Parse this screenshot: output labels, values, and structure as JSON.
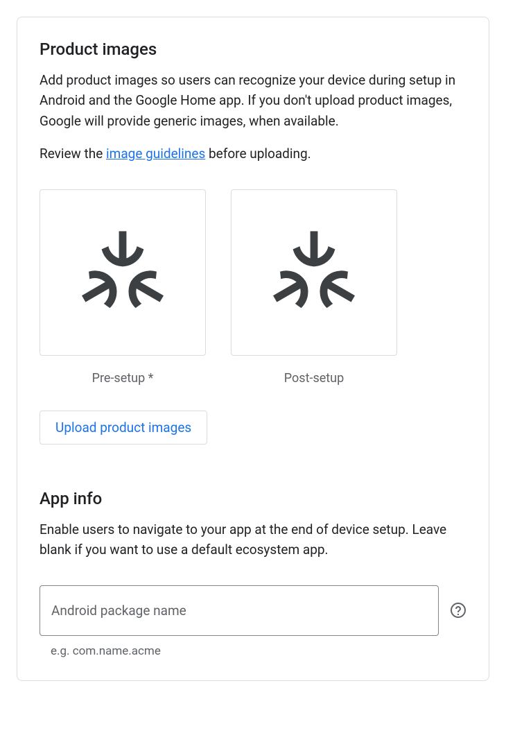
{
  "productImages": {
    "title": "Product images",
    "description": "Add product images so users can recognize your device during setup in Android and the Google Home app. If you don't upload product images, Google will provide generic images, when available.",
    "reviewPrefix": "Review the ",
    "reviewLink": "image guidelines",
    "reviewSuffix": " before uploading.",
    "slots": {
      "preSetup": "Pre-setup *",
      "postSetup": "Post-setup"
    },
    "uploadButton": "Upload product images"
  },
  "appInfo": {
    "title": "App info",
    "description": "Enable users to navigate to your app at the end of device setup. Leave blank if you want to use a default ecosystem app.",
    "packageField": {
      "label": "Android package name",
      "value": "",
      "hint": "e.g. com.name.acme"
    }
  }
}
